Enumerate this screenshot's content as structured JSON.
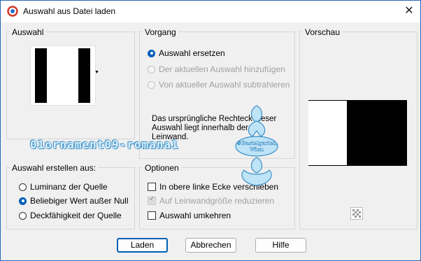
{
  "window": {
    "title": "Auswahl aus Datei laden"
  },
  "groups": {
    "auswahl": {
      "label": "Auswahl"
    },
    "vorgang": {
      "label": "Vorgang",
      "options": [
        {
          "label": "Auswahl ersetzen",
          "selected": true,
          "enabled": true
        },
        {
          "label": "Der aktuellen Auswahl hinzufügen",
          "selected": false,
          "enabled": false
        },
        {
          "label": "Von aktueller Auswahl subtrahieren",
          "selected": false,
          "enabled": false
        }
      ],
      "info": [
        "Das ursprüngliche Rechteck dieser",
        "Auswahl liegt innerhalb der",
        "Leinwand."
      ]
    },
    "vorschau": {
      "label": "Vorschau"
    },
    "erstellen": {
      "label": "Auswahl erstellen aus:",
      "options": [
        {
          "label": "Luminanz der Quelle",
          "selected": false
        },
        {
          "label": "Beliebiger Wert außer Null",
          "selected": true
        },
        {
          "label": "Deckfähigkeit der Quelle",
          "selected": false
        }
      ]
    },
    "optionen": {
      "label": "Optionen",
      "checks": [
        {
          "label": "In obere linke Ecke verschieben",
          "checked": false,
          "enabled": true
        },
        {
          "label": "Auf Leinwandgröße reduzieren",
          "checked": true,
          "enabled": false
        },
        {
          "label": "Auswahl umkehren",
          "checked": false,
          "enabled": true
        }
      ]
    }
  },
  "buttons": {
    "load": "Laden",
    "cancel": "Abbrechen",
    "help": "Hilfe"
  },
  "watermark": {
    "text": "01ornament09-romana1",
    "logo_lines": [
      "©Bastelgarten",
      "Wien"
    ]
  },
  "colors": {
    "accent": "#005fb8",
    "watermark": "#3a90c8"
  }
}
